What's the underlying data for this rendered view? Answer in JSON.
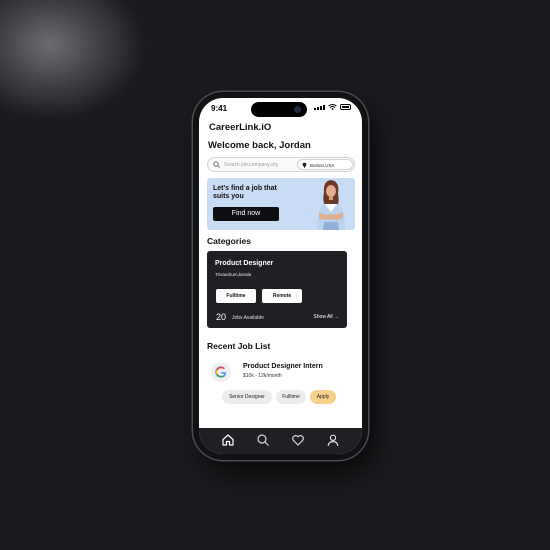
{
  "status_bar": {
    "time": "9:41"
  },
  "app": {
    "brand": "CareerLink.iO",
    "welcome": "Welcome back, Jordan"
  },
  "search": {
    "placeholder": "Search job,company,city",
    "location": "Boston,USA"
  },
  "banner": {
    "tagline": "Let's find a job that suits you",
    "cta": "Find now"
  },
  "categories": {
    "heading": "Categories",
    "card": {
      "role": "Product Designer",
      "location": "Trivandrum,kerala",
      "chips": [
        "Fulltime",
        "Remote"
      ],
      "count": "20",
      "count_label": "Jobs Available",
      "show_all": "Show All →"
    }
  },
  "recent": {
    "heading": "Recent Job List",
    "job": {
      "title": "Product Designer Intern",
      "salary": "$10k - 12k/month",
      "tags": [
        "Senior Designer",
        "Fulltime"
      ],
      "apply": "Apply"
    }
  },
  "tabbar": {
    "icons": [
      "home-icon",
      "search-icon",
      "heart-icon",
      "profile-icon"
    ]
  },
  "colors": {
    "banner_bg": "#c8dcf5",
    "card_bg": "#1f2024",
    "apply_bg": "#f7d08b",
    "tabbar_bg": "#1f2024"
  }
}
